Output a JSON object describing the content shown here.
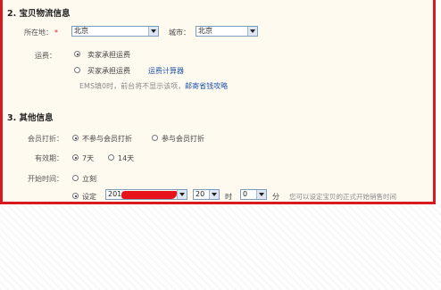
{
  "logistics": {
    "title": "2. 宝贝物流信息",
    "location_label": "所在地：",
    "required_mark": "*",
    "province_value": "北京",
    "city_label": "城市：",
    "city_value": "北京",
    "freight_label": "运费：",
    "seller_pays": "卖家承担运费",
    "buyer_pays": "买家承担运费",
    "freight_calculator": "运费计算器",
    "ems_note": "EMS填0时，前台将不显示该项，",
    "postage_tips": "邮寄省钱攻略"
  },
  "other": {
    "title": "3. 其他信息",
    "member_discount_label": "会员打折：",
    "no_discount": "不参与会员打折",
    "join_discount": "参与会员打折",
    "validity_label": "有效期：",
    "days_7": "7天",
    "days_14": "14天",
    "start_time_label": "开始时间：",
    "immediately": "立刻",
    "set_label": "设定",
    "date_value": "201",
    "hour_value": "20",
    "hour_unit": "时",
    "minute_value": "0",
    "minute_unit": "分",
    "start_time_hint": "您可以设定宝贝的正式开始销售时间"
  },
  "colors": {
    "border": "#d9181f",
    "panel_bg": "#fffaf0",
    "link": "#2255aa"
  }
}
